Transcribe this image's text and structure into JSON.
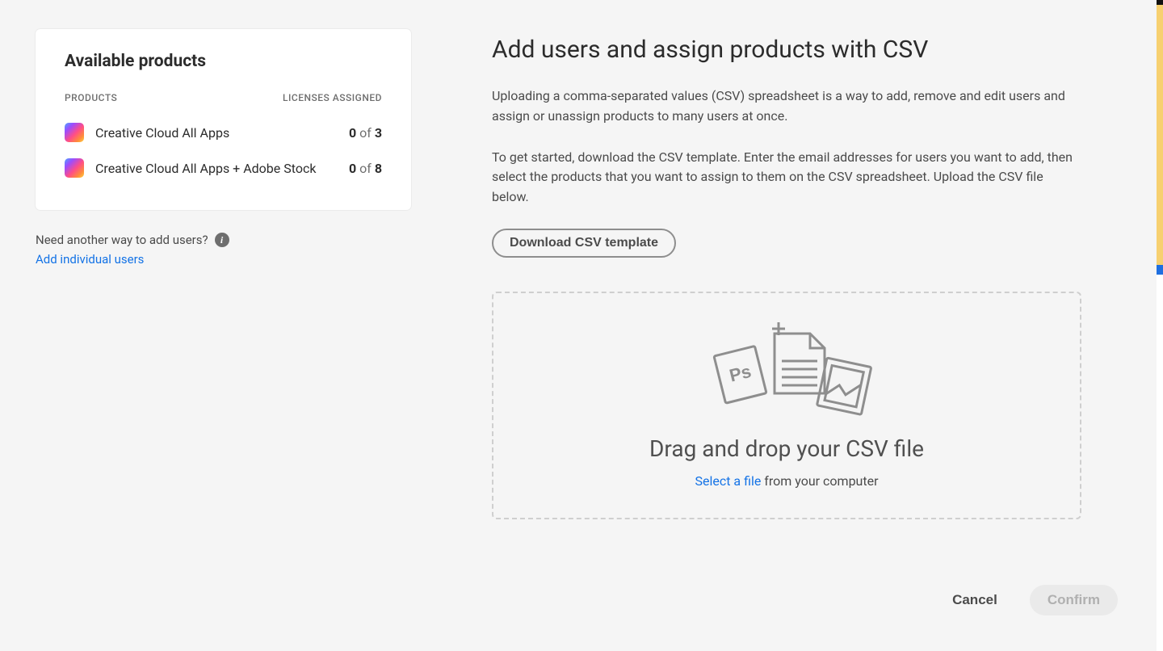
{
  "sidebar": {
    "card_title": "Available products",
    "col_products": "PRODUCTS",
    "col_licenses": "LICENSES ASSIGNED",
    "products": [
      {
        "name": "Creative Cloud All Apps",
        "used": "0",
        "of": " of ",
        "total": "3"
      },
      {
        "name": "Creative Cloud All Apps + Adobe Stock",
        "used": "0",
        "of": " of ",
        "total": "8"
      }
    ],
    "prompt": "Need another way to add users?",
    "link": "Add individual users"
  },
  "main": {
    "title": "Add users and assign products with CSV",
    "para1": "Uploading a comma-separated values (CSV) spreadsheet is a way to add, remove and edit users and assign or unassign products to many users at once.",
    "para2": "To get started, download the CSV template. Enter the email addresses for users you want to add, then select the products that you want to assign to them on the CSV spreadsheet. Upload the CSV file below.",
    "download_btn": "Download CSV template",
    "drop_title": "Drag and drop your CSV file",
    "select_file": "Select a file",
    "from_computer": " from your computer"
  },
  "footer": {
    "cancel": "Cancel",
    "confirm": "Confirm"
  }
}
